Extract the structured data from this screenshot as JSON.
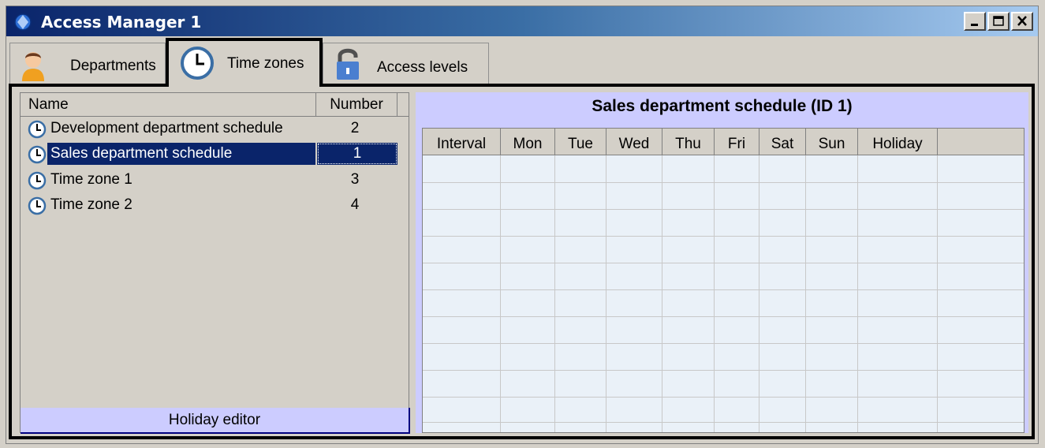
{
  "window": {
    "title": "Access Manager 1"
  },
  "tabs": [
    {
      "label": "Departments",
      "icon": "person-icon"
    },
    {
      "label": "Time zones",
      "icon": "clock-icon",
      "active": true
    },
    {
      "label": "Access levels",
      "icon": "padlock-icon"
    }
  ],
  "list": {
    "headers": {
      "name": "Name",
      "number": "Number"
    },
    "rows": [
      {
        "name": "Development department schedule",
        "number": "2"
      },
      {
        "name": "Sales department schedule",
        "number": "1",
        "selected": true
      },
      {
        "name": "Time zone 1",
        "number": "3"
      },
      {
        "name": "Time zone 2",
        "number": "4"
      }
    ],
    "holiday_button": "Holiday editor"
  },
  "schedule": {
    "title": "Sales department schedule (ID 1)",
    "columns": [
      "Interval",
      "Mon",
      "Tue",
      "Wed",
      "Thu",
      "Fri",
      "Sat",
      "Sun",
      "Holiday"
    ]
  },
  "colors": {
    "selection": "#0a246a",
    "panel": "#ccccff",
    "grid": "#eaf1f8"
  }
}
